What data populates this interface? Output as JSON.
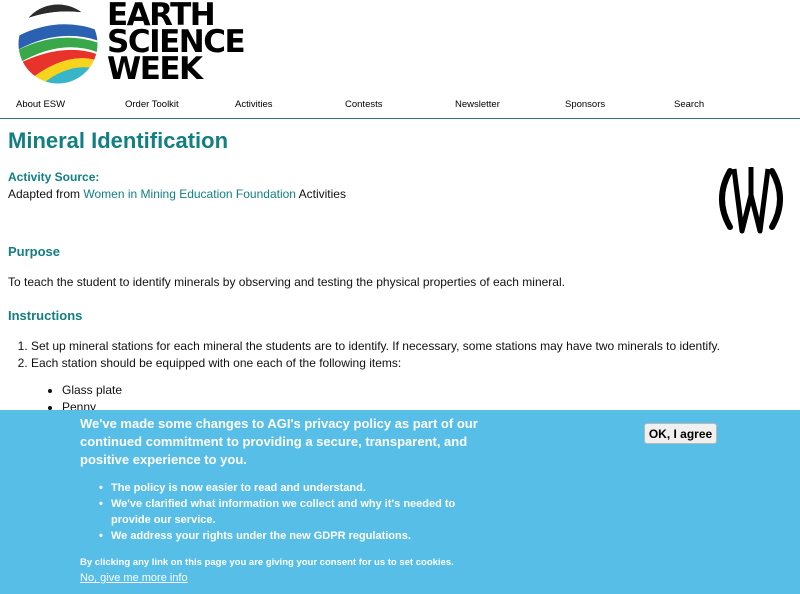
{
  "site": {
    "logo_lines": [
      "EARTH",
      "SCIENCE",
      "WEEK"
    ]
  },
  "nav": {
    "items": [
      "About ESW",
      "Order Toolkit",
      "Activities",
      "Contests",
      "Newsletter",
      "Sponsors",
      "Search"
    ]
  },
  "page": {
    "title": "Mineral Identification",
    "activity_source_label": "Activity Source:",
    "source_prefix": "Adapted from",
    "source_link": "Women in Mining Education Foundation",
    "source_suffix": "Activities",
    "purpose_heading": "Purpose",
    "purpose_text": "To teach the student to identify minerals by observing and testing the physical properties of each mineral.",
    "instructions_heading": "Instructions",
    "steps": [
      "Set up mineral stations for each mineral the students are to identify. If necessary, some stations may have two minerals to identify.",
      "Each station should be equipped with one each of the following items:"
    ],
    "items": [
      "Glass plate",
      "Penny"
    ]
  },
  "cookie_banner": {
    "title": "We've made some changes to AGI's privacy policy as part of our continued commitment to providing a secure, transparent, and positive experience to you.",
    "points": [
      "The policy is now easier to read and understand.",
      "We've clarified what information we collect and why it's needed to provide our service.",
      "We address your rights under the new GDPR regulations."
    ],
    "consent_text": "By clicking any link on this page you are giving your consent for us to set cookies.",
    "more_info_link": "No, give me more info",
    "ok_button": "OK, I agree",
    "background_color": "#57bee7"
  },
  "colors": {
    "accent": "#127f82"
  }
}
